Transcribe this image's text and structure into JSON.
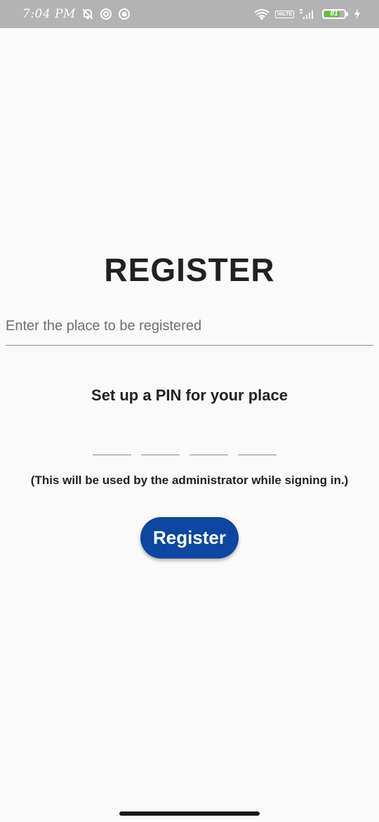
{
  "status_bar": {
    "time": "7:04 PM",
    "volte_top": "Vo",
    "volte_bottom": "LTE",
    "battery_level": "81",
    "battery_level_value": 81,
    "icons": [
      "mute-bell-icon",
      "vpn-icon",
      "at-icon",
      "wifi-icon",
      "volte-icon",
      "signal-icon",
      "battery-icon",
      "charging-icon"
    ]
  },
  "colors": {
    "status_bar": "#b3b3b3",
    "background": "#fafafa",
    "accent": "#0d47a1",
    "battery_fill": "#5ec23c"
  },
  "form": {
    "title": "REGISTER",
    "place_placeholder": "Enter the place to be registered",
    "place_value": "",
    "pin_heading": "Set up a PIN for your place",
    "pin_digits": [
      "",
      "",
      "",
      ""
    ],
    "pin_note": "(This will be used by the administrator while signing in.)",
    "register_label": "Register"
  }
}
